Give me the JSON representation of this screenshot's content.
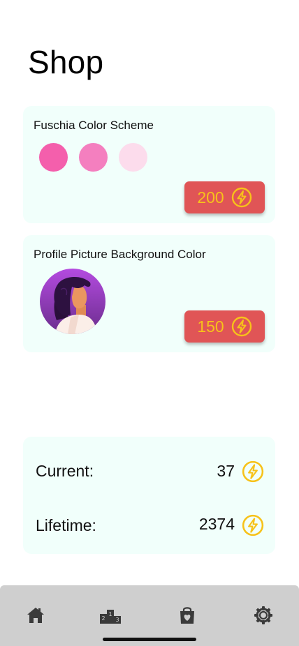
{
  "page": {
    "title": "Shop"
  },
  "shop_items": [
    {
      "title": "Fuschia Color Scheme",
      "swatches": [
        "#f45fac",
        "#f47fbf",
        "#fcdcec"
      ],
      "price": "200"
    },
    {
      "title": "Profile Picture Background Color",
      "price": "150"
    }
  ],
  "stats": {
    "current_label": "Current:",
    "current_value": "37",
    "lifetime_label": "Lifetime:",
    "lifetime_value": "2374"
  },
  "nav": {
    "items": [
      {
        "icon": "home-icon"
      },
      {
        "icon": "leaderboard-podium-icon"
      },
      {
        "icon": "shop-bag-heart-icon"
      },
      {
        "icon": "settings-gear-icon"
      }
    ]
  },
  "colors": {
    "card_bg": "#f1fffb",
    "price_button": "#e05556",
    "currency_accent": "#f7c21a",
    "navbar_bg": "#cfcfcf"
  }
}
